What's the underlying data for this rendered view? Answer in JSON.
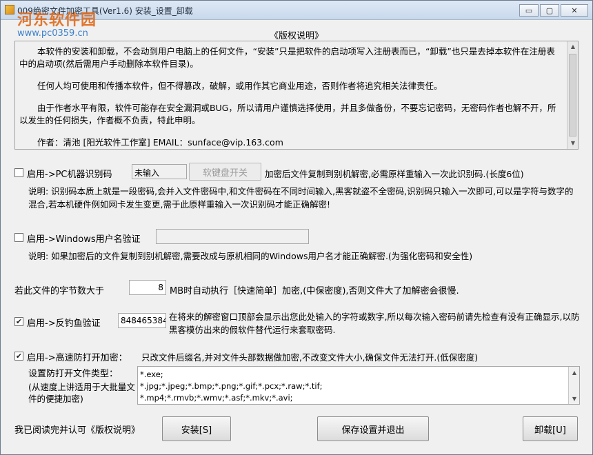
{
  "window": {
    "title": "009绝密文件加密工具(Ver1.6)    安装_设置_卸载",
    "controls": {
      "minimize": "▭",
      "maximize": "▢",
      "close": "✕"
    }
  },
  "watermark": {
    "line1": "河东软件园",
    "line2": "www.pc0359.cn"
  },
  "license": {
    "title": "《版权说明》",
    "p1": "本软件的安装和卸载，不会动到用户电脑上的任何文件，“安装”只是把软件的启动项写入注册表而已，“卸载”也只是去掉本软件在注册表中的启动项(然后需用户手动删除本软件目录)。",
    "p2": "任何人均可使用和传播本软件，但不得篡改，破解，或用作其它商业用途，否则作者将追究相关法律责任。",
    "p3": "由于作者水平有限，软件可能存在安全漏洞或BUG，所以请用户谨慎选择使用，并且多做备份，不要忘记密码，无密码作者也解不开，所以发生的任何损失，作者概不负责，特此申明。",
    "author": "作者：清池 [阳光软件工作室]      EMAIL：sunface@vip.163.com"
  },
  "pc_id": {
    "checked": false,
    "label": "启用->PC机器识别码",
    "value": "未输入",
    "keyboard_button": "软键盘开关",
    "note": "加密后文件复制到别机解密,必需原样重输入一次此识别码.(长度6位)",
    "desc": "说明: 识别码本质上就是一段密码,会并入文件密码中,和文件密码在不同时间输入,黑客就盗不全密码,识别码只输入一次即可,可以是字符与数字的混合,若本机硬件例如网卡发生变更,需于此原样重输入一次识别码才能正确解密!"
  },
  "win_user": {
    "checked": false,
    "label": "启用->Windows用户名验证",
    "value": "",
    "desc": "说明: 如果加密后的文件复制到别机解密,需要改成与原机相同的Windows用户名才能正确解密.(为强化密码和安全性)"
  },
  "size_limit": {
    "prefix": "若此文件的字节数大于",
    "value": "8",
    "suffix": "MB时自动执行［快速简单］加密,(中保密度),否则文件大了加解密会很慢."
  },
  "anti_phishing": {
    "checked": true,
    "label": "启用->反钓鱼验证",
    "value": "848465384",
    "desc": "在将来的解密窗口顶部会显示出您此处输入的字符或数字,所以每次输入密码前请先检查有没有正确显示,以防黑客模仿出来的假软件替代运行来套取密码."
  },
  "fast_protect": {
    "checked": true,
    "label": "启用->高速防打开加密：",
    "desc": "只改文件后缀名,并对文件头部数据做加密,不改变文件大小,确保文件无法打开.(低保密度)",
    "types_label": "设置防打开文件类型：",
    "types_note": "(从速度上讲适用于大批量文件的便捷加密)",
    "types_lines": [
      "*.exe;",
      "*.jpg;*.jpeg;*.bmp;*.png;*.gif;*.pcx;*.raw;*.tif;",
      "*.mp4;*.rmvb;*.wmv;*.asf;*.mkv;*.avi;"
    ]
  },
  "footer": {
    "agree_text": "我已阅读完并认可《版权说明》",
    "install_button": "安装[S]",
    "save_exit_button": "保存设置并退出",
    "uninstall_button": "卸载[U]"
  },
  "icons": {
    "checked_mark": "✔",
    "scroll_up": "▲",
    "scroll_down": "▼"
  }
}
